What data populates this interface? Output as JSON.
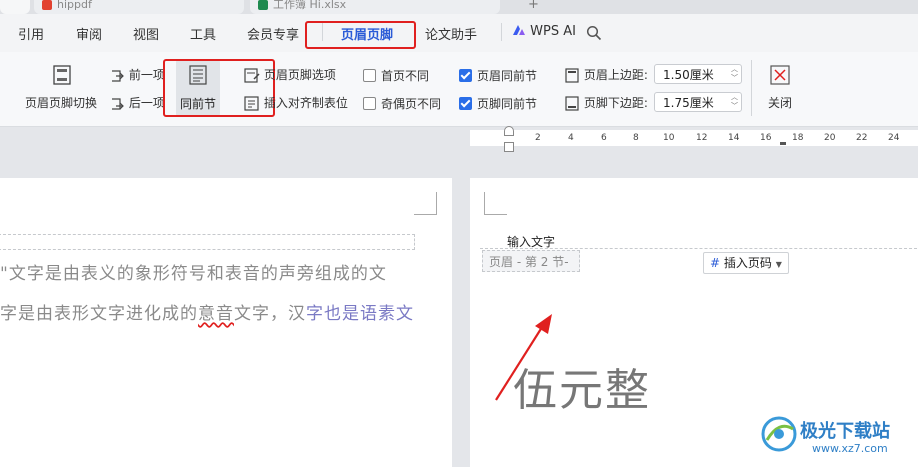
{
  "window_tabs": [
    {
      "label": "hippdf",
      "icon_color": "#e2412f"
    },
    {
      "label": "工作簿 Hi.xlsx",
      "icon_color": "#1e8a4f"
    },
    {
      "label": "+"
    }
  ],
  "menu": {
    "items": [
      "引用",
      "审阅",
      "视图",
      "工具",
      "会员专享",
      "页眉页脚",
      "论文助手"
    ],
    "active": "页眉页脚",
    "wps_ai": "WPS AI"
  },
  "ribbon": {
    "header_footer_switch": "页眉页脚切换",
    "prev_item": "前一项",
    "next_item": "后一项",
    "same_as_prev": "同前节",
    "hf_options": "页眉页脚选项",
    "insert_tab": "插入对齐制表位",
    "first_page_diff": {
      "label": "首页不同",
      "checked": false
    },
    "odd_even_diff": {
      "label": "奇偶页不同",
      "checked": false
    },
    "header_same_prev": {
      "label": "页眉同前节",
      "checked": true
    },
    "footer_same_prev": {
      "label": "页脚同前节",
      "checked": true
    },
    "header_top_margin": {
      "label": "页眉上边距:",
      "value": "1.50厘米"
    },
    "footer_bottom_margin": {
      "label": "页脚下边距:",
      "value": "1.75厘米"
    },
    "close": "关闭"
  },
  "ruler": {
    "ticks": [
      "2",
      "4",
      "6",
      "8",
      "10",
      "12",
      "14",
      "16",
      "18",
      "20",
      "22",
      "24"
    ]
  },
  "left_page": {
    "line1": "\"文字是由表义的象形符号和表音的声旁组成的文",
    "line2_a": "字是由表形文字进化成的",
    "line2_b": "意音",
    "line2_c": "文字，汉",
    "line2_d": "字也是语素文"
  },
  "right_page": {
    "header_text": "输入文字",
    "header_tag": "页眉  - 第 2 节-",
    "insert_page_number": "插入页码",
    "big_text": "伍元整"
  },
  "watermark": {
    "title": "极光下载站",
    "url": "www.xz7.com"
  },
  "colors": {
    "accent": "#2a5bd7",
    "highlight_box": "#e0201f"
  }
}
